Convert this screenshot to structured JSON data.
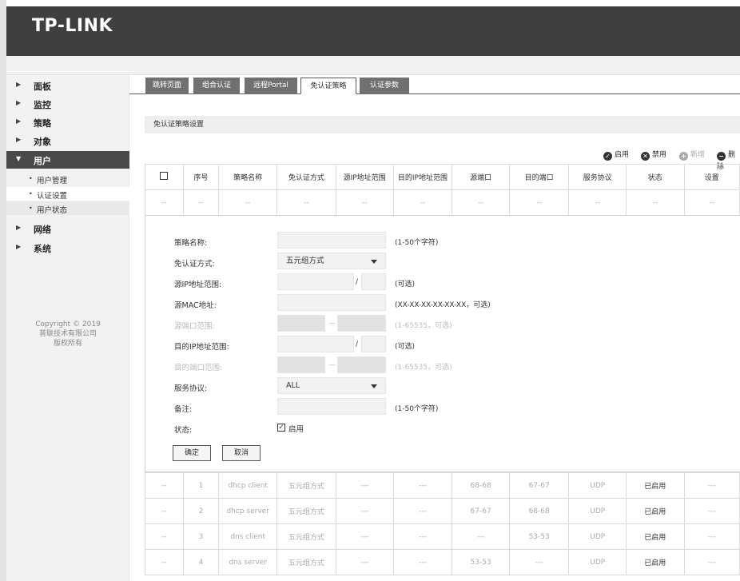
{
  "brand": {
    "logo": "TP-LINK"
  },
  "sidebar": {
    "items": [
      {
        "label": "面板"
      },
      {
        "label": "监控"
      },
      {
        "label": "策略"
      },
      {
        "label": "对象"
      },
      {
        "label": "用户"
      },
      {
        "label": "网络"
      },
      {
        "label": "系统"
      }
    ],
    "sub_items": [
      {
        "label": "用户管理"
      },
      {
        "label": "认证设置"
      },
      {
        "label": "用户状态"
      }
    ],
    "copyright": [
      "Copyright © 2019",
      "普联技术有限公司",
      "版权所有"
    ]
  },
  "tabs": [
    {
      "label": "跳转页面"
    },
    {
      "label": "组合认证"
    },
    {
      "label": "远程Portal"
    },
    {
      "label": "免认证策略"
    },
    {
      "label": "认证参数"
    }
  ],
  "section_title": "免认证策略设置",
  "toolbar": {
    "enable": "启用",
    "disable": "禁用",
    "add": "新增",
    "delete": "删除"
  },
  "table": {
    "headers": [
      "序号",
      "策略名称",
      "免认证方式",
      "源IP地址范围",
      "目的IP地址范围",
      "源端口",
      "目的端口",
      "服务协议",
      "状态",
      "设置"
    ],
    "placeholder_row": [
      "--",
      "--",
      "--",
      "--",
      "--",
      "--",
      "--",
      "--",
      "--",
      "--",
      "--"
    ],
    "rows": [
      [
        "--",
        "1",
        "dhcp client",
        "五元组方式",
        "---",
        "---",
        "68-68",
        "67-67",
        "UDP",
        "已启用",
        "---"
      ],
      [
        "--",
        "2",
        "dhcp server",
        "五元组方式",
        "---",
        "---",
        "67-67",
        "68-68",
        "UDP",
        "已启用",
        "---"
      ],
      [
        "--",
        "3",
        "dns client",
        "五元组方式",
        "---",
        "---",
        "---",
        "53-53",
        "UDP",
        "已启用",
        "---"
      ],
      [
        "--",
        "4",
        "dns server",
        "五元组方式",
        "---",
        "---",
        "53-53",
        "---",
        "UDP",
        "已启用",
        "---"
      ]
    ]
  },
  "form": {
    "name_label": "策略名称:",
    "name_hint": "(1-50个字符)",
    "method_label": "免认证方式:",
    "method_value": "五元组方式",
    "src_ip_label": "源IP地址范围:",
    "src_ip_hint": "(可选)",
    "src_mac_label": "源MAC地址:",
    "src_mac_hint": "(XX-XX-XX-XX-XX-XX，可选)",
    "src_port_label": "源端口范围:",
    "src_port_hint": "(1-65535，可选)",
    "dst_ip_label": "目的IP地址范围:",
    "dst_ip_hint": "(可选)",
    "dst_port_label": "目的端口范围:",
    "dst_port_hint": "(1-65535，可选)",
    "proto_label": "服务协议:",
    "proto_value": "ALL",
    "remark_label": "备注:",
    "remark_hint": "(1-50个字符)",
    "status_label": "状态:",
    "status_value": "启用",
    "ok": "确定",
    "cancel": "取消",
    "slash": "/",
    "dash": "—"
  },
  "colors": {
    "header_bg": "#3f3f3f",
    "active_nav": "#4a4a4a",
    "tab_bg": "#707070"
  }
}
